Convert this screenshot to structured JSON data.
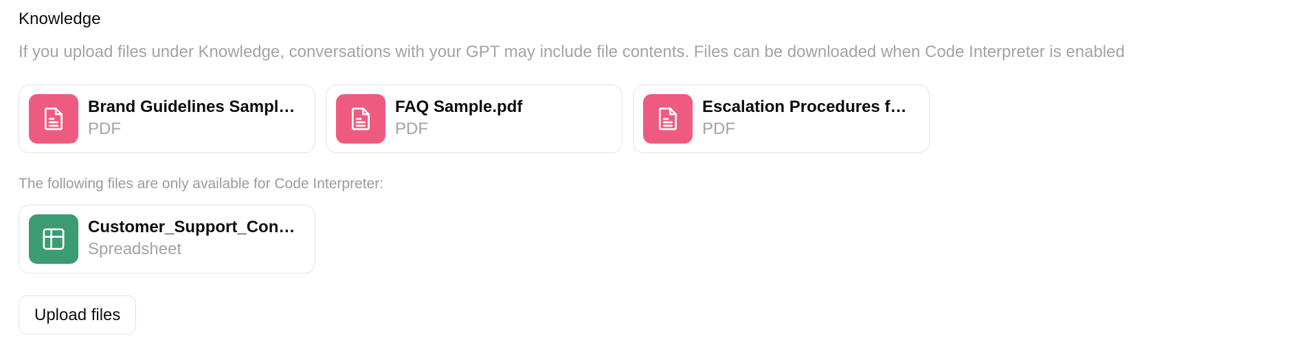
{
  "knowledge": {
    "title": "Knowledge",
    "description": "If you upload files under Knowledge, conversations with your GPT may include file contents. Files can be downloaded when Code Interpreter is enabled",
    "files": [
      {
        "name": "Brand Guidelines Sample....",
        "type": "PDF",
        "icon": "document-icon",
        "color": "#ef5b80"
      },
      {
        "name": "FAQ Sample.pdf",
        "type": "PDF",
        "icon": "document-icon",
        "color": "#ef5b80"
      },
      {
        "name": "Escalation Procedures for ...",
        "type": "PDF",
        "icon": "document-icon",
        "color": "#ef5b80"
      }
    ]
  },
  "code_interpreter": {
    "note": "The following files are only available for Code Interpreter:",
    "files": [
      {
        "name": "Customer_Support_Conve...",
        "type": "Spreadsheet",
        "icon": "spreadsheet-icon",
        "color": "#3b9b73"
      }
    ]
  },
  "upload": {
    "label": "Upload files"
  }
}
